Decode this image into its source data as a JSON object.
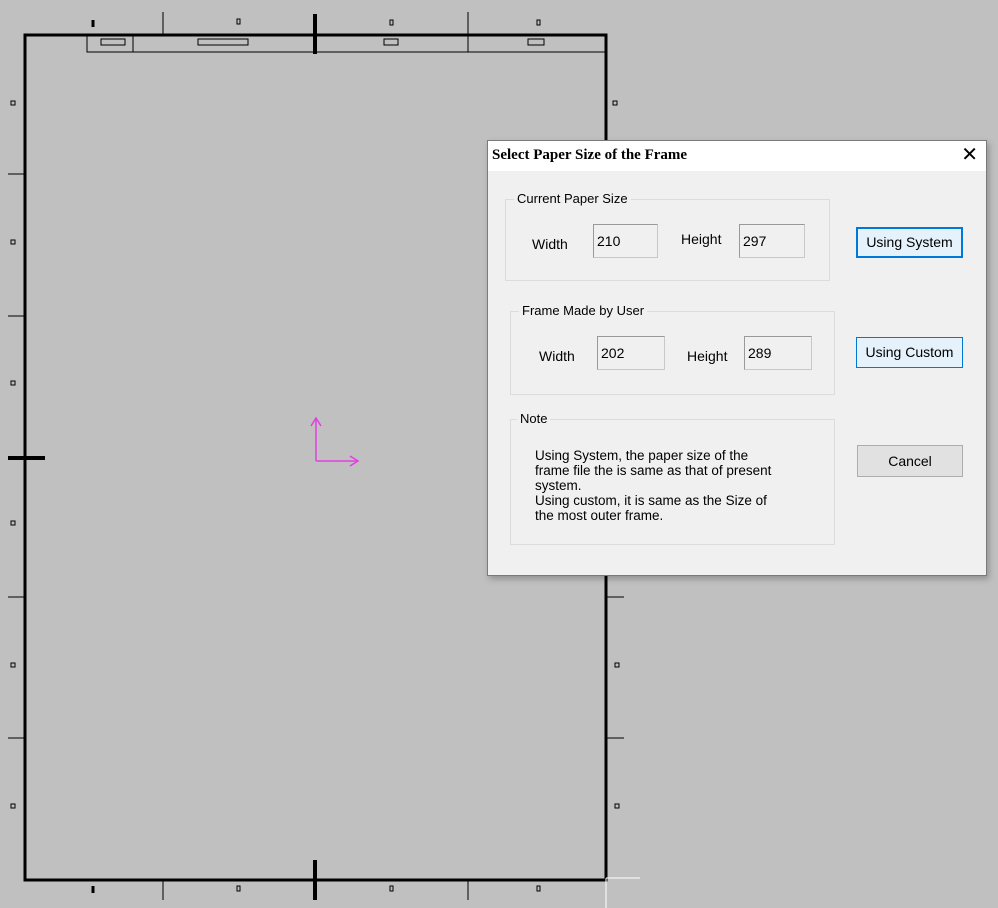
{
  "dialog": {
    "title": "Select Paper Size of the Frame",
    "close_icon": "close-icon",
    "current_group": {
      "label": "Current Paper Size",
      "width_label": "Width",
      "width_value": "210",
      "height_label": "Height",
      "height_value": "297"
    },
    "user_group": {
      "label": "Frame Made by User",
      "width_label": "Width",
      "width_value": "202",
      "height_label": "Height",
      "height_value": "289"
    },
    "note_group": {
      "label": "Note",
      "line1": "Using System, the paper size of the",
      "line2": "frame file the is same as that of present",
      "line3": "system.",
      "line4": "Using custom, it is same as the Size of",
      "line5": "the most outer frame."
    },
    "buttons": {
      "system": "Using System",
      "custom": "Using Custom",
      "cancel": "Cancel"
    }
  },
  "colors": {
    "canvas_bg": "#c0c0c0",
    "frame_line": "#000000",
    "axis_icon": "#e040e0",
    "button_accent": "#0078d7"
  }
}
